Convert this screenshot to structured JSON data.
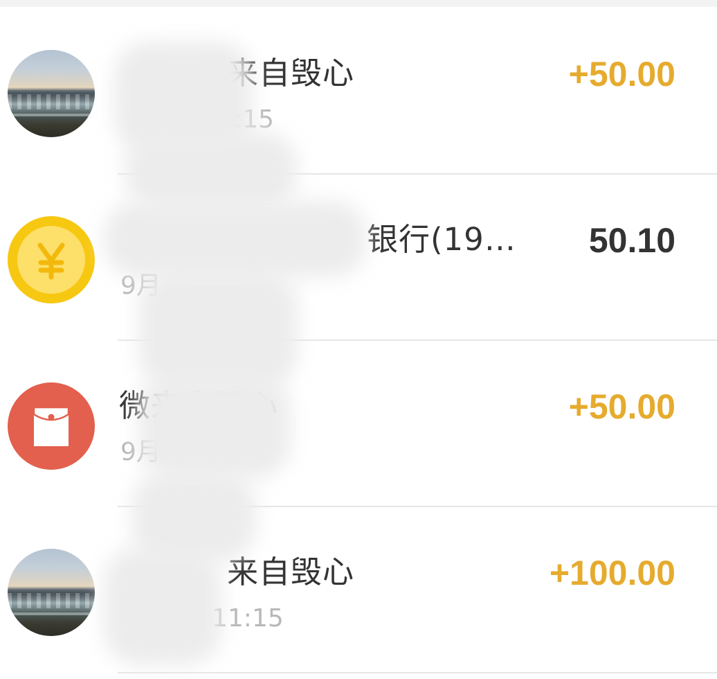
{
  "transactions": [
    {
      "title": "来自毁心",
      "time": ":15",
      "amount": "+50.00",
      "type": "income",
      "icon": "landscape-avatar"
    },
    {
      "title": "银行(19…",
      "time": "9月",
      "amount": "50.10",
      "type": "expense",
      "icon": "yen-coin-icon"
    },
    {
      "title": "微来自毁心",
      "time": "9月",
      "amount": "+50.00",
      "type": "income",
      "icon": "red-envelope-icon"
    },
    {
      "title": "来自毁心",
      "time": "11:15",
      "amount": "+100.00",
      "type": "income",
      "icon": "landscape-avatar"
    }
  ],
  "colors": {
    "income": "#e6ab2e",
    "expense": "#333333",
    "coin_outer": "#f7c812",
    "coin_inner": "#fde06a",
    "red_envelope": "#e2604d"
  }
}
